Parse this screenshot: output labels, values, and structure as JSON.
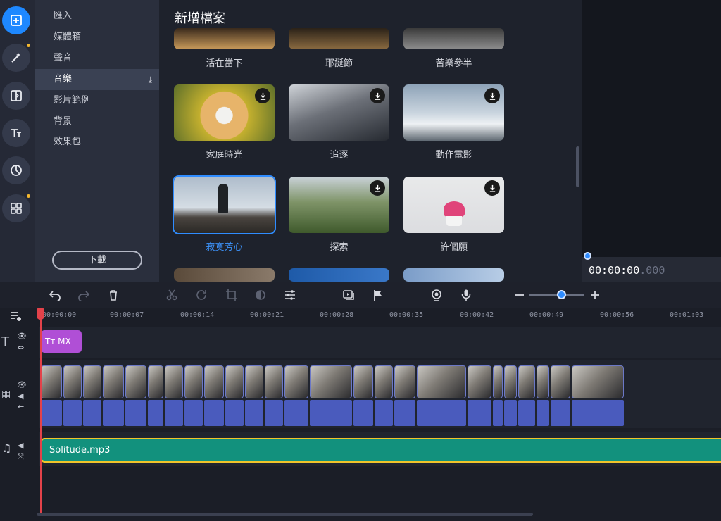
{
  "sidebar": {
    "items": [
      {
        "label": "匯入"
      },
      {
        "label": "媒體箱"
      },
      {
        "label": "聲音"
      },
      {
        "label": "音樂"
      },
      {
        "label": "影片範例"
      },
      {
        "label": "背景"
      },
      {
        "label": "效果包"
      }
    ],
    "active_index": 3,
    "download_button": "下載"
  },
  "rail": {
    "icons": [
      "import-icon",
      "magic-wand-icon",
      "transition-icon",
      "text-icon",
      "sticker-icon",
      "more-tools-icon"
    ]
  },
  "content": {
    "title": "新增檔案",
    "row0": [
      "活在當下",
      "耶誕節",
      "苦樂參半"
    ],
    "row1": [
      "家庭時光",
      "追逐",
      "動作電影"
    ],
    "row2": [
      "寂寞芳心",
      "探索",
      "許個願"
    ],
    "selected": "寂寞芳心"
  },
  "preview": {
    "timecode_main": "00:00:00",
    "timecode_ms": ".000"
  },
  "timeline": {
    "ticks": [
      "00:00:00",
      "00:00:07",
      "00:00:14",
      "00:00:21",
      "00:00:28",
      "00:00:35",
      "00:00:42",
      "00:00:49",
      "00:00:56",
      "00:01:03"
    ],
    "title_clip_label": "MX",
    "music_clip_name": "Solitude.mp3"
  },
  "colors": {
    "accent": "#1e88ff",
    "music_clip": "#12917d",
    "title_clip": "#b04fd6",
    "playhead": "#e3424a"
  }
}
